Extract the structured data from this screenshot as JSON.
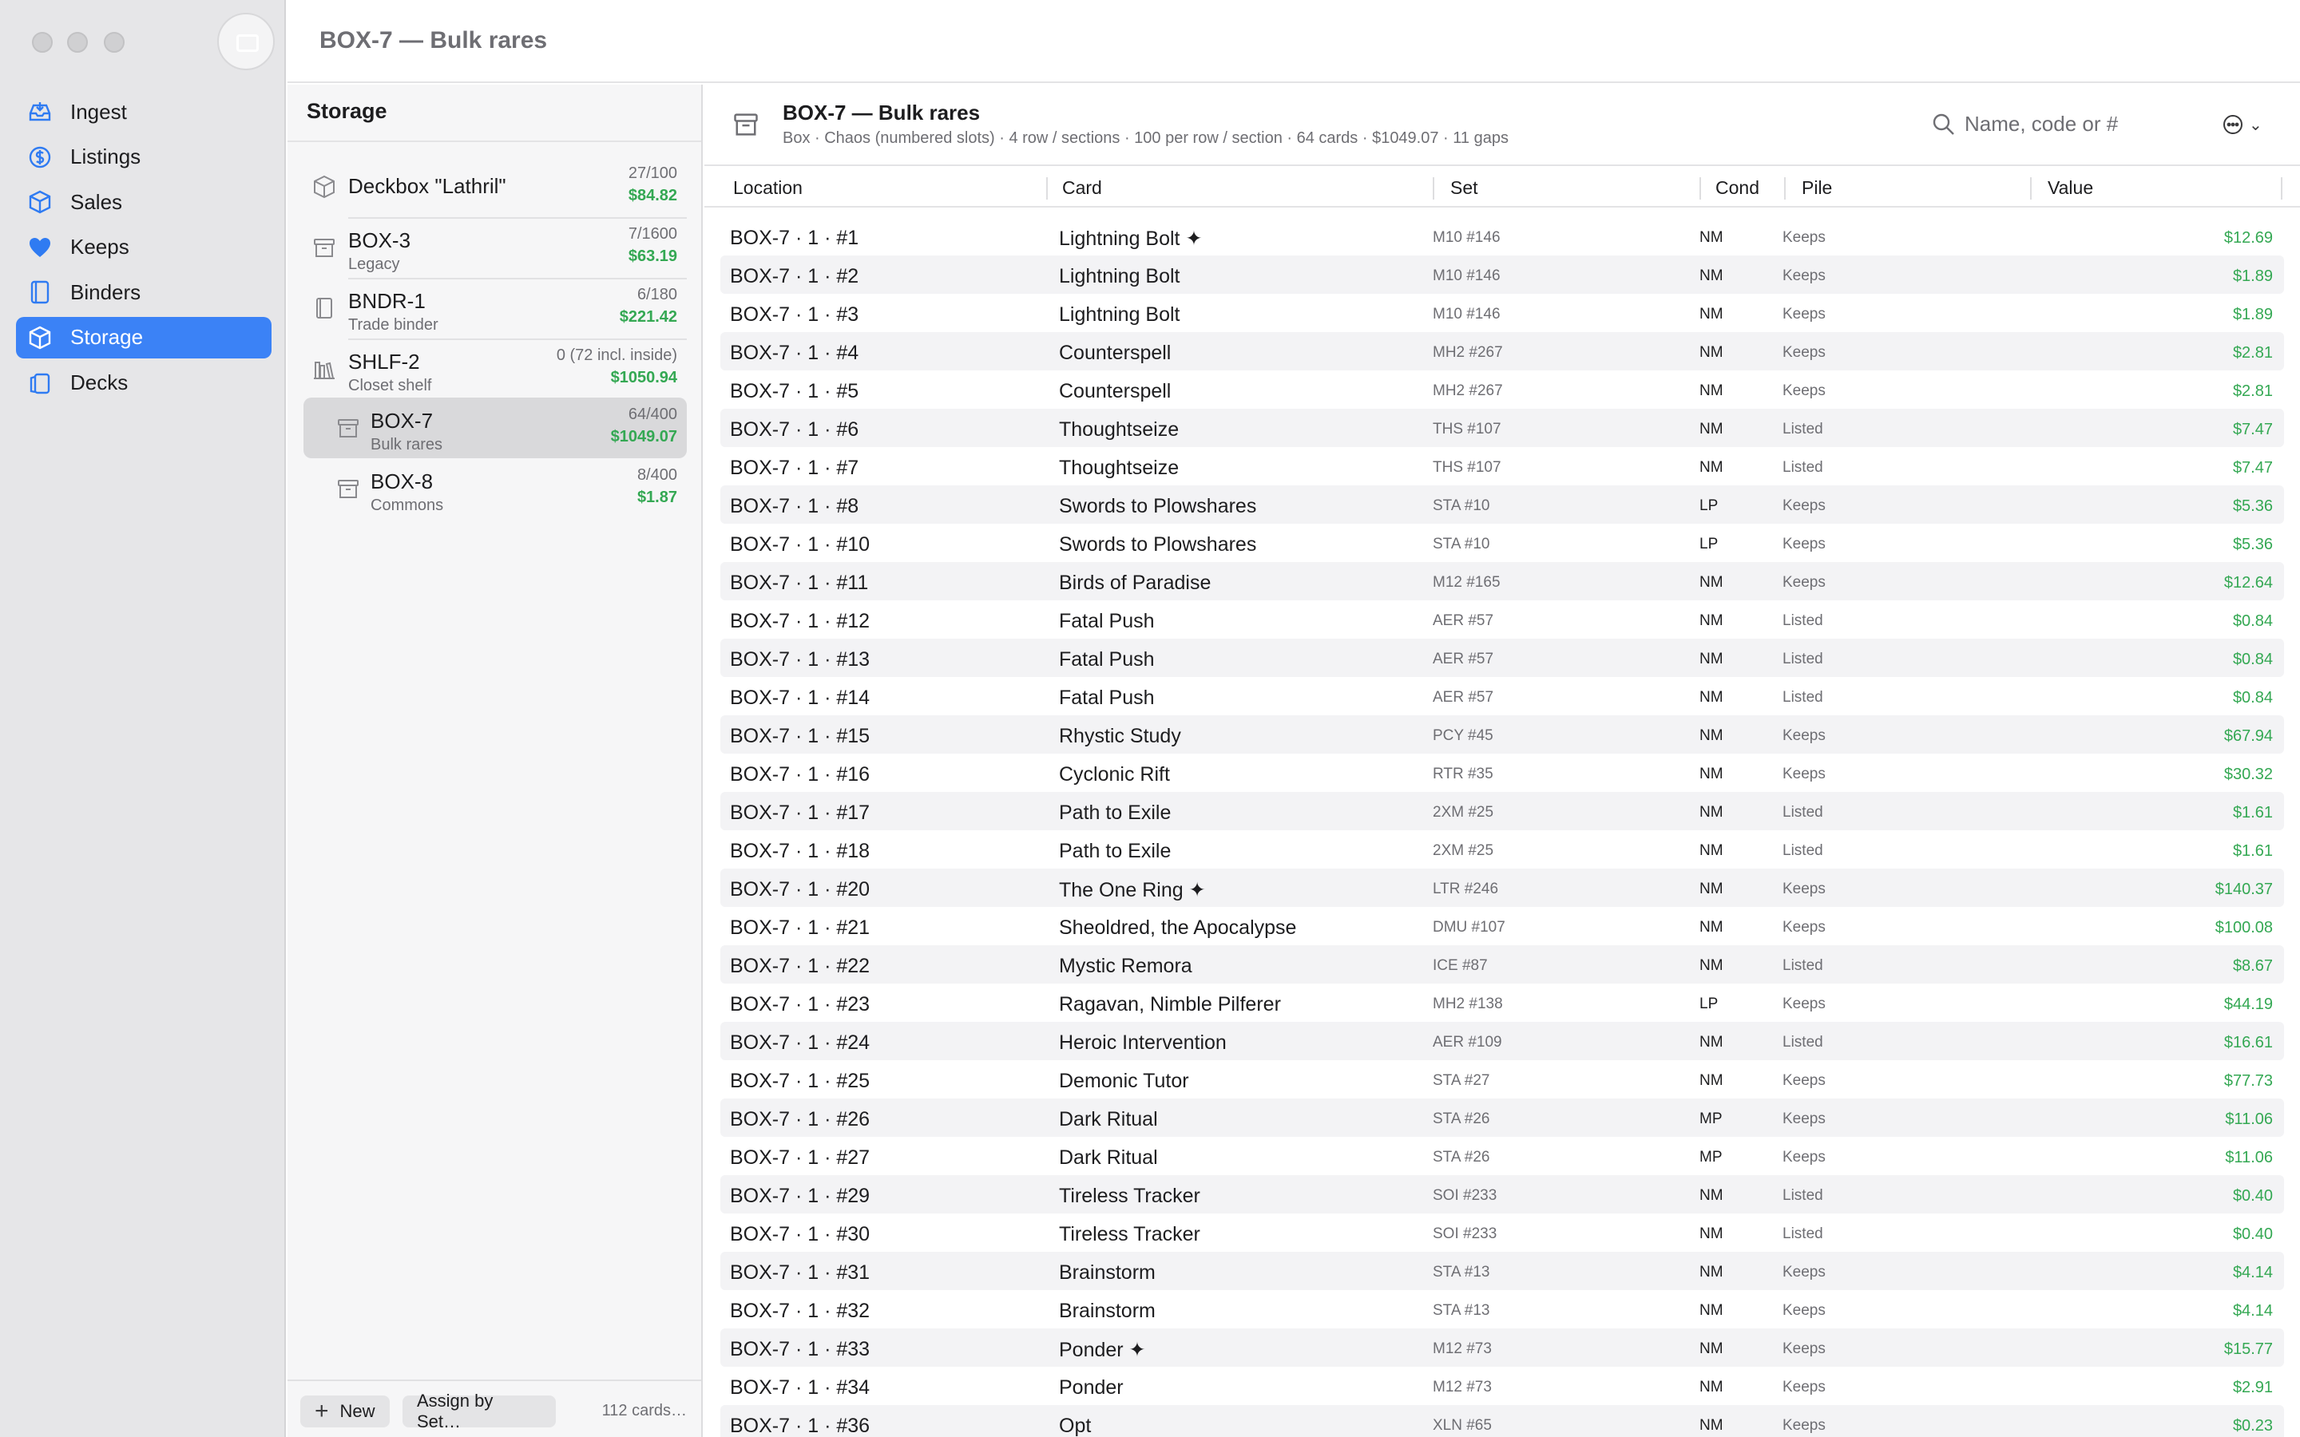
{
  "window": {
    "title": "BOX-7 — Bulk rares"
  },
  "sidebar": {
    "items": [
      {
        "label": "Ingest",
        "icon": "tray-icon"
      },
      {
        "label": "Listings",
        "icon": "dollar-icon"
      },
      {
        "label": "Sales",
        "icon": "cube-icon"
      },
      {
        "label": "Keeps",
        "icon": "heart-icon"
      },
      {
        "label": "Binders",
        "icon": "book-icon"
      },
      {
        "label": "Storage",
        "icon": "cube-icon",
        "active": true
      },
      {
        "label": "Decks",
        "icon": "cards-icon"
      }
    ]
  },
  "storage": {
    "title": "Storage",
    "items": [
      {
        "name": "Deckbox \"Lathril\"",
        "sub": "",
        "count": "27/100",
        "value": "$84.82",
        "icon": "cube-icon"
      },
      {
        "name": "BOX-3",
        "sub": "Legacy",
        "count": "7/1600",
        "value": "$63.19",
        "icon": "archive-icon"
      },
      {
        "name": "BNDR-1",
        "sub": "Trade binder",
        "count": "6/180",
        "value": "$221.42",
        "icon": "book-icon"
      },
      {
        "name": "SHLF-2",
        "sub": "Closet shelf",
        "count": "0 (72 incl. inside)",
        "value": "$1050.94",
        "icon": "shelf-icon"
      },
      {
        "name": "BOX-7",
        "sub": "Bulk rares",
        "count": "64/400",
        "value": "$1049.07",
        "icon": "archive-icon",
        "selected": true
      },
      {
        "name": "BOX-8",
        "sub": "Commons",
        "count": "8/400",
        "value": "$1.87",
        "icon": "archive-icon"
      }
    ],
    "footer": {
      "new_label": "New",
      "assign_label": "Assign by Set…",
      "count_label": "112 cards…"
    }
  },
  "detail": {
    "title": "BOX-7 — Bulk rares",
    "meta": "Box · Chaos (numbered slots) · 4 row / sections · 100 per row / section · 64 cards · $1049.07 · 11 gaps",
    "search_placeholder": "Name, code or #"
  },
  "table": {
    "columns": [
      "Location",
      "Card",
      "Set",
      "Cond",
      "Pile",
      "Value"
    ],
    "rows": [
      [
        "BOX-7 · 1 · #1",
        "Lightning Bolt ✦",
        "M10 #146",
        "NM",
        "Keeps",
        "$12.69"
      ],
      [
        "BOX-7 · 1 · #2",
        "Lightning Bolt",
        "M10 #146",
        "NM",
        "Keeps",
        "$1.89"
      ],
      [
        "BOX-7 · 1 · #3",
        "Lightning Bolt",
        "M10 #146",
        "NM",
        "Keeps",
        "$1.89"
      ],
      [
        "BOX-7 · 1 · #4",
        "Counterspell",
        "MH2 #267",
        "NM",
        "Keeps",
        "$2.81"
      ],
      [
        "BOX-7 · 1 · #5",
        "Counterspell",
        "MH2 #267",
        "NM",
        "Keeps",
        "$2.81"
      ],
      [
        "BOX-7 · 1 · #6",
        "Thoughtseize",
        "THS #107",
        "NM",
        "Listed",
        "$7.47"
      ],
      [
        "BOX-7 · 1 · #7",
        "Thoughtseize",
        "THS #107",
        "NM",
        "Listed",
        "$7.47"
      ],
      [
        "BOX-7 · 1 · #8",
        "Swords to Plowshares",
        "STA #10",
        "LP",
        "Keeps",
        "$5.36"
      ],
      [
        "BOX-7 · 1 · #10",
        "Swords to Plowshares",
        "STA #10",
        "LP",
        "Keeps",
        "$5.36"
      ],
      [
        "BOX-7 · 1 · #11",
        "Birds of Paradise",
        "M12 #165",
        "NM",
        "Keeps",
        "$12.64"
      ],
      [
        "BOX-7 · 1 · #12",
        "Fatal Push",
        "AER #57",
        "NM",
        "Listed",
        "$0.84"
      ],
      [
        "BOX-7 · 1 · #13",
        "Fatal Push",
        "AER #57",
        "NM",
        "Listed",
        "$0.84"
      ],
      [
        "BOX-7 · 1 · #14",
        "Fatal Push",
        "AER #57",
        "NM",
        "Listed",
        "$0.84"
      ],
      [
        "BOX-7 · 1 · #15",
        "Rhystic Study",
        "PCY #45",
        "NM",
        "Keeps",
        "$67.94"
      ],
      [
        "BOX-7 · 1 · #16",
        "Cyclonic Rift",
        "RTR #35",
        "NM",
        "Keeps",
        "$30.32"
      ],
      [
        "BOX-7 · 1 · #17",
        "Path to Exile",
        "2XM #25",
        "NM",
        "Listed",
        "$1.61"
      ],
      [
        "BOX-7 · 1 · #18",
        "Path to Exile",
        "2XM #25",
        "NM",
        "Listed",
        "$1.61"
      ],
      [
        "BOX-7 · 1 · #20",
        "The One Ring ✦",
        "LTR #246",
        "NM",
        "Keeps",
        "$140.37"
      ],
      [
        "BOX-7 · 1 · #21",
        "Sheoldred, the Apocalypse",
        "DMU #107",
        "NM",
        "Keeps",
        "$100.08"
      ],
      [
        "BOX-7 · 1 · #22",
        "Mystic Remora",
        "ICE #87",
        "NM",
        "Listed",
        "$8.67"
      ],
      [
        "BOX-7 · 1 · #23",
        "Ragavan, Nimble Pilferer",
        "MH2 #138",
        "LP",
        "Keeps",
        "$44.19"
      ],
      [
        "BOX-7 · 1 · #24",
        "Heroic Intervention",
        "AER #109",
        "NM",
        "Listed",
        "$16.61"
      ],
      [
        "BOX-7 · 1 · #25",
        "Demonic Tutor",
        "STA #27",
        "NM",
        "Keeps",
        "$77.73"
      ],
      [
        "BOX-7 · 1 · #26",
        "Dark Ritual",
        "STA #26",
        "MP",
        "Keeps",
        "$11.06"
      ],
      [
        "BOX-7 · 1 · #27",
        "Dark Ritual",
        "STA #26",
        "MP",
        "Keeps",
        "$11.06"
      ],
      [
        "BOX-7 · 1 · #29",
        "Tireless Tracker",
        "SOI #233",
        "NM",
        "Listed",
        "$0.40"
      ],
      [
        "BOX-7 · 1 · #30",
        "Tireless Tracker",
        "SOI #233",
        "NM",
        "Listed",
        "$0.40"
      ],
      [
        "BOX-7 · 1 · #31",
        "Brainstorm",
        "STA #13",
        "NM",
        "Keeps",
        "$4.14"
      ],
      [
        "BOX-7 · 1 · #32",
        "Brainstorm",
        "STA #13",
        "NM",
        "Keeps",
        "$4.14"
      ],
      [
        "BOX-7 · 1 · #33",
        "Ponder ✦",
        "M12 #73",
        "NM",
        "Keeps",
        "$15.77"
      ],
      [
        "BOX-7 · 1 · #34",
        "Ponder",
        "M12 #73",
        "NM",
        "Keeps",
        "$2.91"
      ],
      [
        "BOX-7 · 1 · #36",
        "Opt",
        "XLN #65",
        "NM",
        "Keeps",
        "$0.23"
      ]
    ]
  },
  "colors": {
    "accent": "#3b82f6",
    "value_green": "#34a853",
    "sidebar_bg": "#e6e6e8"
  }
}
